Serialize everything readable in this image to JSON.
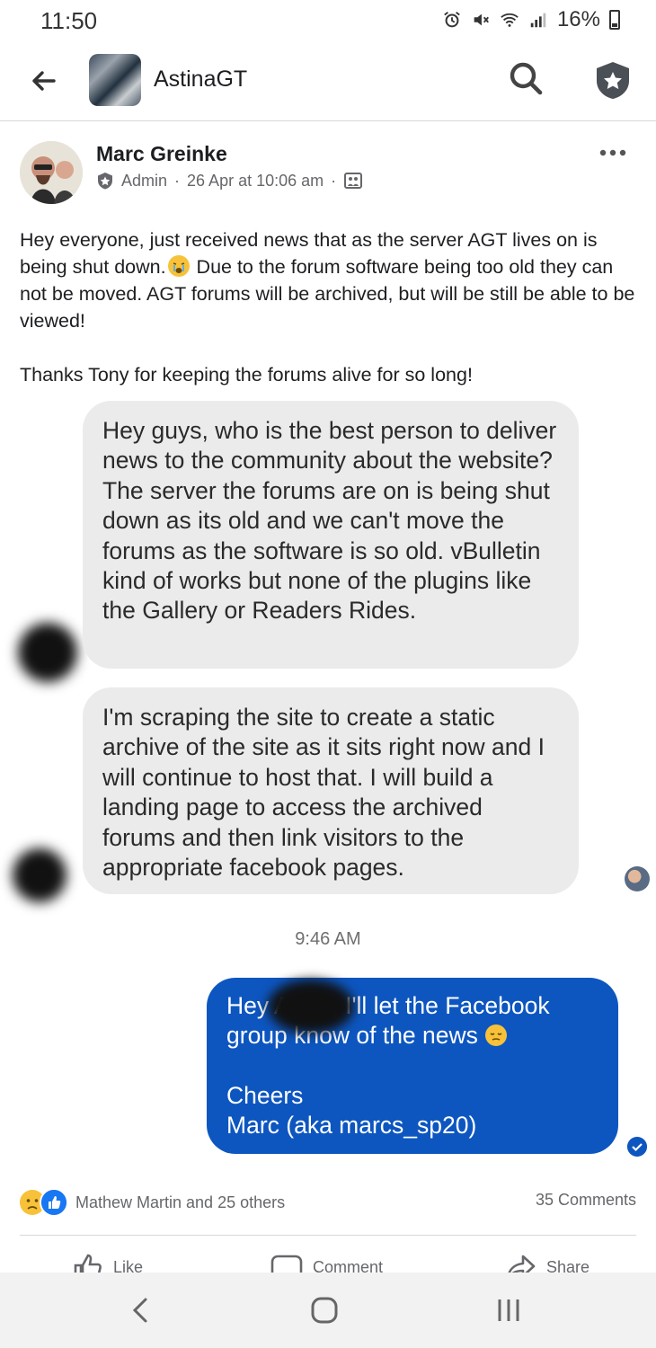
{
  "status_bar": {
    "time": "11:50",
    "battery": "16%"
  },
  "header": {
    "group_name": "AstinaGT"
  },
  "post": {
    "author": "Marc Greinke",
    "role": "Admin",
    "date": "26 Apr at 10:06 am",
    "text_part1": "Hey everyone, just received news that as the server AGT lives on is being shut down.",
    "text_part2": " Due to the forum software being too old they can not be moved. AGT forums will be archived, but will be still be able to be viewed!",
    "thanks": "Thanks Tony for keeping the forums alive for so long!"
  },
  "screenshot": {
    "message1": "Hey guys, who is the best person to deliver news to the community about the website? The server the forums are on is being shut down as its old and we can't move the forums as the software is so old. vBulletin kind of works but none of the plugins like the Gallery or Readers Rides.",
    "message2": "I'm scraping the site to create a static archive of the site as it sits right now and I will continue to host that. I will build a landing page to access the archived forums and then link visitors to the appropriate facebook pages.",
    "timestamp": "9:46 AM",
    "reply_line1": "Hey A    ony, I'll let the Facebook group know of the news",
    "reply_cheers": "Cheers",
    "reply_sign": "Marc (aka marcs_sp20)"
  },
  "reactions": {
    "names": "Mathew Martin and 25 others",
    "comments": "35 Comments"
  },
  "actions": {
    "like": "Like",
    "comment": "Comment",
    "share": "Share"
  },
  "colors": {
    "accent": "#0d56c0",
    "like_blue": "#1877f2",
    "bubble_grey": "#ebebeb"
  }
}
